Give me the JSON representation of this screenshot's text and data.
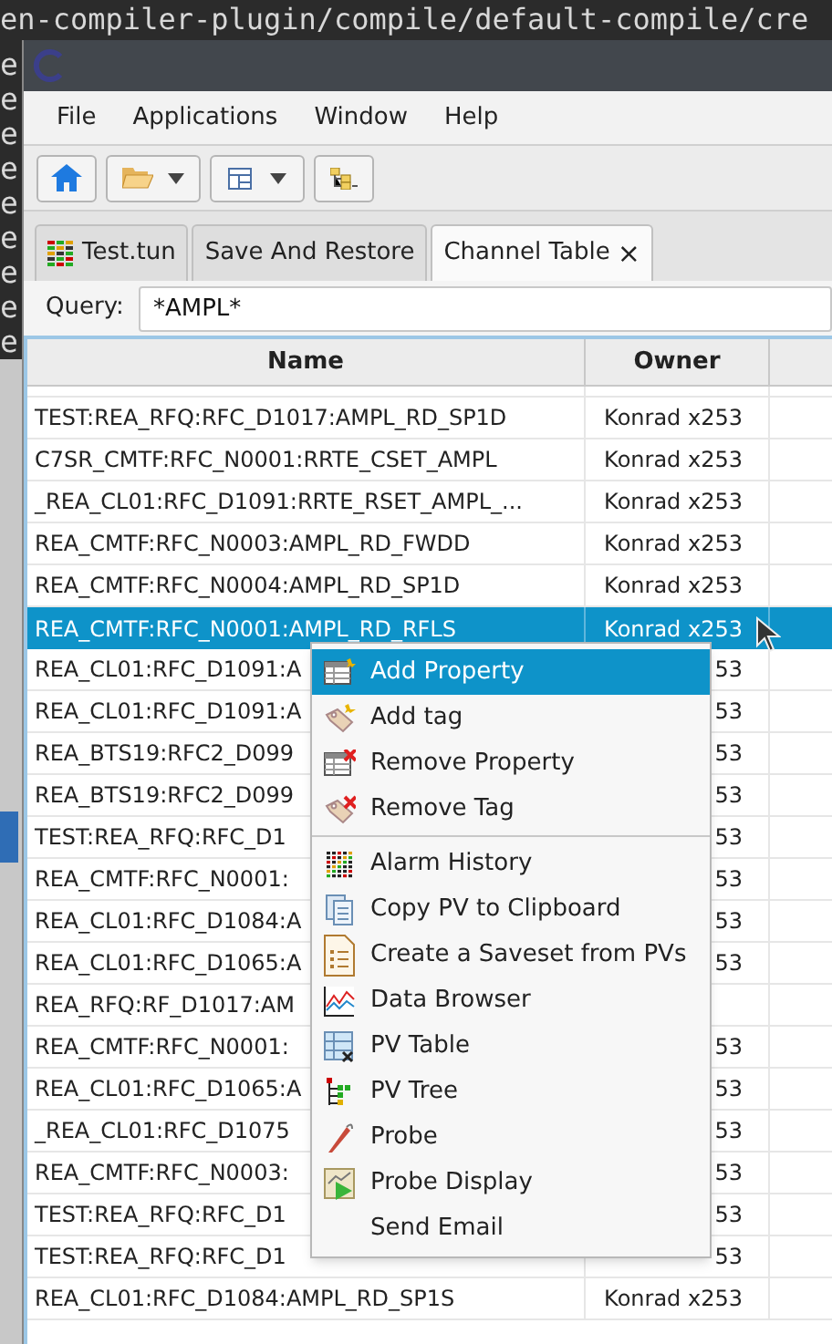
{
  "terminal": {
    "lines": [
      "en-compiler-plugin/compile/default-compile/cre"
    ],
    "gutter": [
      "e",
      "e",
      "e",
      "e",
      "e",
      "e",
      "e",
      "e",
      "e"
    ]
  },
  "menubar": [
    "File",
    "Applications",
    "Window",
    "Help"
  ],
  "tabs": [
    {
      "label": "Test.tun",
      "selected": false
    },
    {
      "label": "Save And Restore",
      "selected": false
    },
    {
      "label": "Channel Table",
      "selected": true,
      "close": "×"
    }
  ],
  "query": {
    "label": "Query:",
    "value": "*AMPL*"
  },
  "table": {
    "columns": [
      "Name",
      "Owner"
    ],
    "rows": [
      {
        "name": "TEST:REA_RFQ:RFC_D1017:AMPL_RD_SP1D",
        "owner": "Konrad x253",
        "selected": false
      },
      {
        "name": "C7SR_CMTF:RFC_N0001:RRTE_CSET_AMPL",
        "owner": "Konrad x253",
        "selected": false
      },
      {
        "name": "_REA_CL01:RFC_D1091:RRTE_RSET_AMPL_...",
        "owner": "Konrad x253",
        "selected": false
      },
      {
        "name": "REA_CMTF:RFC_N0003:AMPL_RD_FWDD",
        "owner": "Konrad x253",
        "selected": false
      },
      {
        "name": "REA_CMTF:RFC_N0004:AMPL_RD_SP1D",
        "owner": "Konrad x253",
        "selected": false
      },
      {
        "name": "REA_CMTF:RFC_N0001:AMPL_RD_RFLS",
        "owner": "Konrad x253",
        "selected": true
      },
      {
        "name": "REA_CL01:RFC_D1091:A",
        "owner": "53",
        "selected": false
      },
      {
        "name": "REA_CL01:RFC_D1091:A",
        "owner": "53",
        "selected": false
      },
      {
        "name": "REA_BTS19:RFC2_D099",
        "owner": "53",
        "selected": false
      },
      {
        "name": "REA_BTS19:RFC2_D099",
        "owner": "53",
        "selected": false
      },
      {
        "name": "TEST:REA_RFQ:RFC_D1",
        "owner": "53",
        "selected": false
      },
      {
        "name": "REA_CMTF:RFC_N0001:",
        "owner": "53",
        "selected": false
      },
      {
        "name": "REA_CL01:RFC_D1084:A",
        "owner": "53",
        "selected": false
      },
      {
        "name": "REA_CL01:RFC_D1065:A",
        "owner": "53",
        "selected": false
      },
      {
        "name": "REA_RFQ:RF_D1017:AM",
        "selected": false
      },
      {
        "name": "REA_CMTF:RFC_N0001:",
        "owner": "53",
        "selected": false
      },
      {
        "name": "REA_CL01:RFC_D1065:A",
        "owner": "53",
        "selected": false
      },
      {
        "name": "_REA_CL01:RFC_D1075",
        "owner": "53",
        "selected": false
      },
      {
        "name": "REA_CMTF:RFC_N0003:",
        "owner": "53",
        "selected": false
      },
      {
        "name": "TEST:REA_RFQ:RFC_D1",
        "owner": "53",
        "selected": false
      },
      {
        "name": "TEST:REA_RFQ:RFC_D1",
        "owner": "53",
        "selected": false
      },
      {
        "name": "REA_CL01:RFC_D1084:AMPL_RD_SP1S",
        "owner": "Konrad x253",
        "selected": false
      }
    ]
  },
  "context_menu": {
    "groups": [
      [
        {
          "label": "Add Property",
          "selected": true
        },
        {
          "label": "Add tag",
          "selected": false
        },
        {
          "label": "Remove Property",
          "selected": false
        },
        {
          "label": "Remove Tag",
          "selected": false
        }
      ],
      [
        {
          "label": "Alarm History",
          "selected": false
        },
        {
          "label": "Copy PV to Clipboard",
          "selected": false
        },
        {
          "label": "Create a Saveset from PVs",
          "selected": false
        },
        {
          "label": "Data Browser",
          "selected": false
        },
        {
          "label": "PV Table",
          "selected": false
        },
        {
          "label": "PV Tree",
          "selected": false
        },
        {
          "label": "Probe",
          "selected": false
        },
        {
          "label": "Probe Display",
          "selected": false
        },
        {
          "label": "Send Email",
          "selected": false
        }
      ]
    ]
  }
}
